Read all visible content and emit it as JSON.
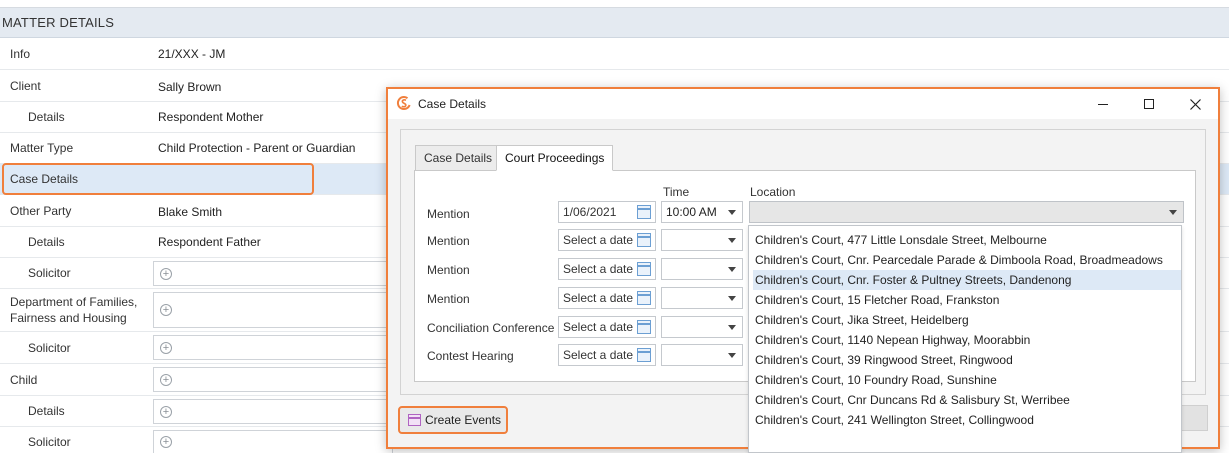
{
  "matter": {
    "header": "MATTER DETAILS",
    "rows": [
      {
        "label": "Info",
        "value": "21/XXX - JM"
      },
      {
        "label": "Client",
        "value": "Sally Brown"
      },
      {
        "label": "Details",
        "value": "Respondent Mother"
      },
      {
        "label": "Matter Type",
        "value": "Child Protection - Parent or Guardian"
      },
      {
        "label": "Case Details",
        "value": ""
      },
      {
        "label": "Other Party",
        "value": "Blake Smith"
      },
      {
        "label": "Details",
        "value": "Respondent Father"
      },
      {
        "label": "Solicitor",
        "value": ""
      },
      {
        "label": "Department of Families, Fairness and Housing",
        "value": ""
      },
      {
        "label": "Solicitor",
        "value": ""
      },
      {
        "label": "Child",
        "value": ""
      },
      {
        "label": "Details",
        "value": ""
      },
      {
        "label": "Solicitor",
        "value": ""
      }
    ],
    "add_glyph": "+"
  },
  "dialog": {
    "title": "Case Details",
    "tabs": [
      {
        "label": "Case Details"
      },
      {
        "label": "Court Proceedings"
      }
    ],
    "headers": {
      "time": "Time",
      "location": "Location"
    },
    "proceedings": [
      {
        "label": "Mention",
        "date": "1/06/2021",
        "time": "10:00 AM"
      },
      {
        "label": "Mention",
        "date": "Select a date",
        "time": ""
      },
      {
        "label": "Mention",
        "date": "Select a date",
        "time": ""
      },
      {
        "label": "Mention",
        "date": "Select a date",
        "time": ""
      },
      {
        "label": "Conciliation Conference",
        "date": "Select a date",
        "time": ""
      },
      {
        "label": "Contest Hearing",
        "date": "Select a date",
        "time": ""
      }
    ],
    "location_options": [
      "Children's Court, 477 Little Lonsdale Street, Melbourne",
      "Children's Court, Cnr. Pearcedale Parade & Dimboola Road, Broadmeadows",
      "Children's Court, Cnr. Foster & Pultney Streets, Dandenong",
      "Children's Court, 15 Fletcher Road, Frankston",
      "Children's Court, Jika Street, Heidelberg",
      "Children's Court, 1140 Nepean Highway, Moorabbin",
      "Children's Court, 39 Ringwood Street, Ringwood",
      "Children's Court, 10 Foundry Road, Sunshine",
      "Children's Court, Cnr Duncans Rd & Salisbury St, Werribee",
      "Children's Court, 241 Wellington Street, Collingwood"
    ],
    "create_events_label": "Create Events"
  },
  "colors": {
    "highlight": "#f07f3c",
    "selected_row": "#dde9f6",
    "header_bg": "#e4eaf1"
  }
}
